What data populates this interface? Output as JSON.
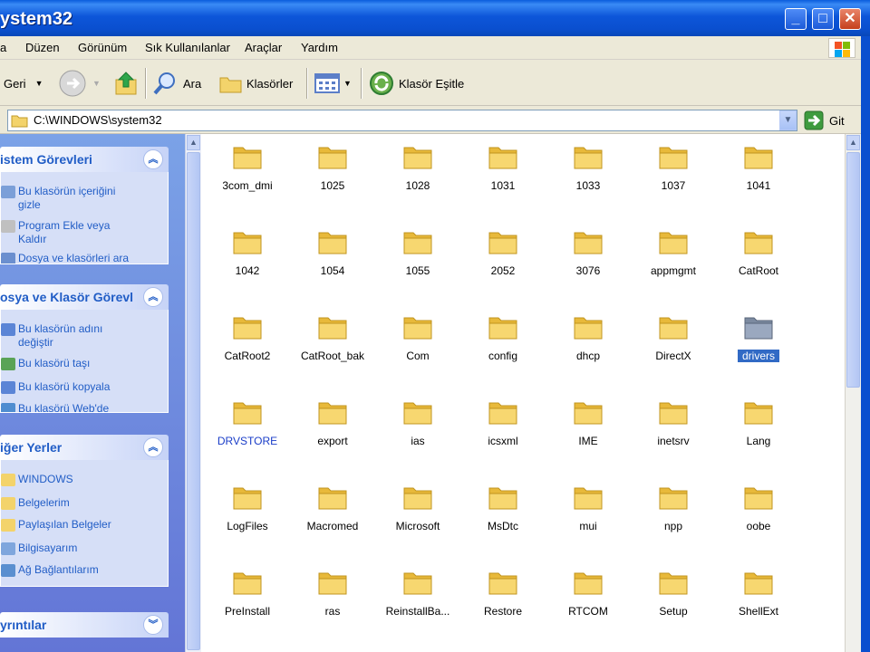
{
  "window": {
    "title": "ystem32",
    "buttons": {
      "minimize": "_",
      "maximize": "□",
      "close": "✕"
    }
  },
  "menu": {
    "items": [
      "a",
      "Düzen",
      "Görünüm",
      "Sık Kullanılanlar",
      "Araçlar",
      "Yardım"
    ]
  },
  "toolbar": {
    "back_label": "Geri",
    "search_label": "Ara",
    "folders_label": "Klasörler",
    "sync_label": "Klasör Eşitle"
  },
  "address": {
    "value": "C:\\WINDOWS\\system32",
    "go_label": "Git"
  },
  "left_panel": {
    "system_tasks": {
      "title": "istem Görevleri",
      "items": [
        "Bu klasörün içeriğini gizle",
        "Program Ekle veya Kaldır",
        "Dosya ve klasörleri ara"
      ]
    },
    "file_tasks": {
      "title": "osya ve Klasör Görevl",
      "items": [
        "Bu klasörün adını değiştir",
        "Bu klasörü taşı",
        "Bu klasörü kopyala",
        "Bu klasörü Web'de"
      ]
    },
    "other_places": {
      "title": "iğer Yerler",
      "items": [
        "WINDOWS",
        "Belgelerim",
        "Paylaşılan Belgeler",
        "Bilgisayarım",
        "Ağ Bağlantılarım"
      ]
    },
    "details": {
      "title": "yrıntılar"
    }
  },
  "folders": [
    [
      "3com_dmi",
      "1025",
      "1028",
      "1031",
      "1033",
      "1037",
      "1041"
    ],
    [
      "1042",
      "1054",
      "1055",
      "2052",
      "3076",
      "appmgmt",
      "CatRoot"
    ],
    [
      "CatRoot2",
      "CatRoot_bak",
      "Com",
      "config",
      "dhcp",
      "DirectX",
      "drivers"
    ],
    [
      "DRVSTORE",
      "export",
      "ias",
      "icsxml",
      "IME",
      "inetsrv",
      "Lang"
    ],
    [
      "LogFiles",
      "Macromed",
      "Microsoft",
      "MsDtc",
      "mui",
      "npp",
      "oobe"
    ],
    [
      "PreInstall",
      "ras",
      "ReinstallBa...",
      "Restore",
      "RTCOM",
      "Setup",
      "ShellExt"
    ]
  ],
  "selected_folder": "drivers",
  "compressed_folder": "DRVSTORE"
}
